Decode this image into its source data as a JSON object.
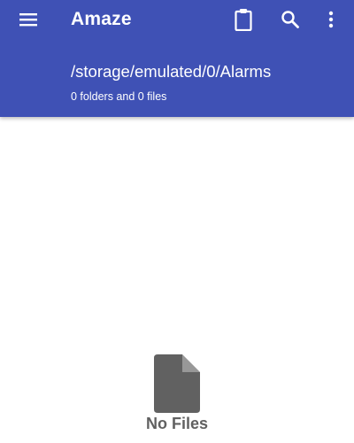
{
  "colors": {
    "primary": "#3f51b5",
    "on_primary": "#ffffff",
    "empty_icon": "#616161",
    "empty_text": "#616161"
  },
  "toolbar": {
    "menu_icon": "hamburger-menu-icon",
    "app_title": "Amaze",
    "actions": [
      {
        "icon": "clipboard-icon"
      },
      {
        "icon": "search-icon"
      },
      {
        "icon": "more-vert-icon"
      }
    ]
  },
  "path_header": {
    "path": "/storage/emulated/0/Alarms",
    "summary": "0 folders and 0 files"
  },
  "empty_state": {
    "icon": "file-icon",
    "label": "No Files"
  }
}
